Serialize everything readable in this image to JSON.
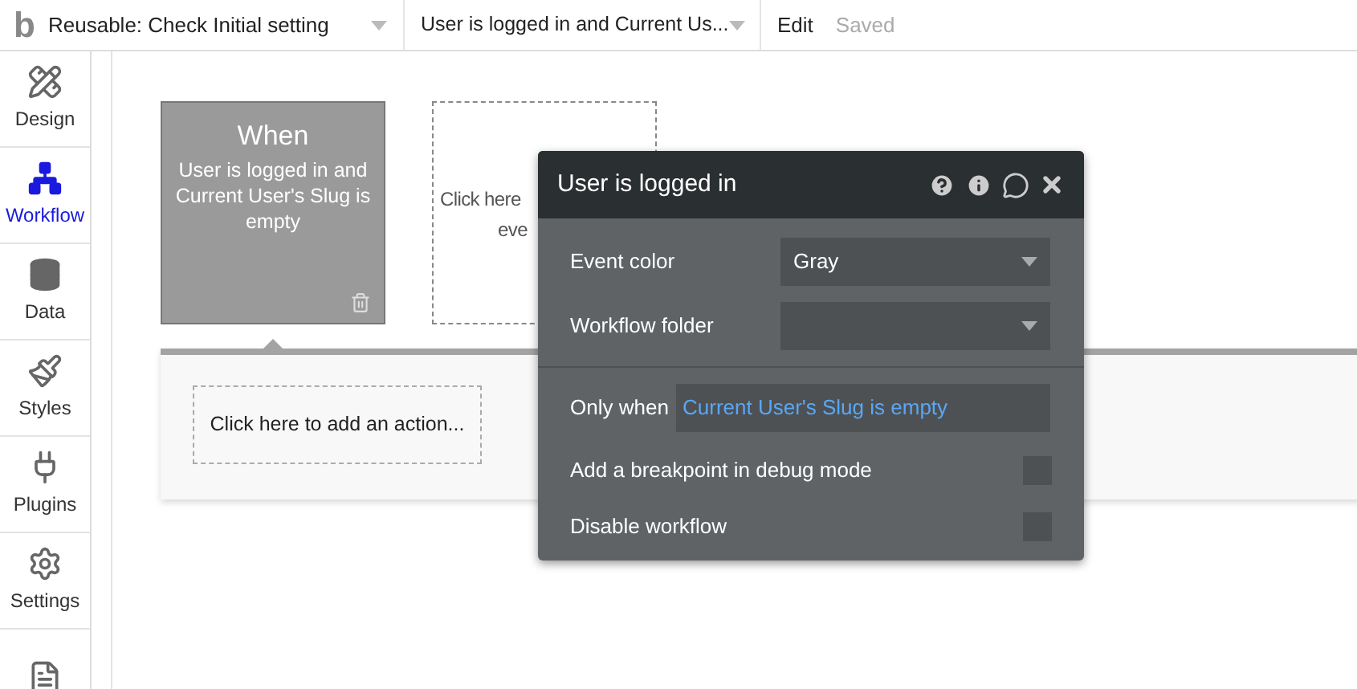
{
  "logo": "b",
  "top_bar": {
    "page_select": "Reusable: Check Initial setting",
    "event_select": "User is logged in and Current Us...",
    "edit": "Edit",
    "saved": "Saved"
  },
  "sidebar": [
    {
      "label": "Design",
      "selected": false
    },
    {
      "label": "Workflow",
      "selected": true
    },
    {
      "label": "Data",
      "selected": false
    },
    {
      "label": "Styles",
      "selected": false
    },
    {
      "label": "Plugins",
      "selected": false
    },
    {
      "label": "Settings",
      "selected": false
    },
    {
      "selected": false
    }
  ],
  "event_card": {
    "title": "When",
    "text": "User is logged in and Current User's Slug is empty"
  },
  "new_event_card": {
    "line_1": "Click here",
    "line_2": "eve"
  },
  "action_area": {
    "placeholder": "Click here to add an action..."
  },
  "popup": {
    "title": "User is logged in",
    "event_color": {
      "label": "Event color",
      "value": "Gray"
    },
    "workflow_folder": {
      "label": "Workflow folder"
    },
    "only_when": {
      "label": "Only when",
      "value": "Current User's Slug is empty"
    },
    "options": [
      {
        "label": "Add a breakpoint in debug mode",
        "checked": false
      },
      {
        "label": "Disable workflow",
        "checked": false
      }
    ]
  }
}
